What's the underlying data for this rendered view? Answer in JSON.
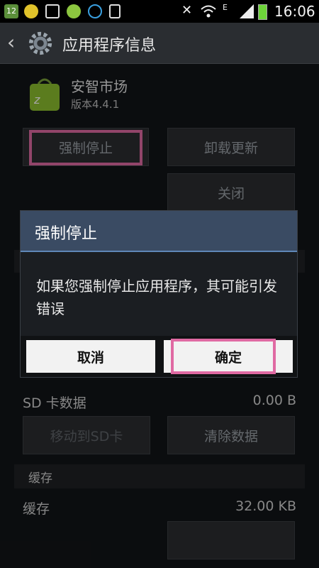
{
  "status_bar": {
    "time": "16:06",
    "left_icons": [
      "notification-12-icon",
      "game-icon",
      "image-icon",
      "plugin-icon",
      "p-app-icon",
      "phone-download-icon"
    ],
    "right_icons": [
      "mute-icon",
      "wifi-icon",
      "signal-e-icon",
      "signal-bars-icon",
      "battery-icon"
    ],
    "network_letter": "E",
    "badge_number": "12"
  },
  "header": {
    "title": "应用程序信息"
  },
  "app": {
    "name": "安智市场",
    "version": "版本4.4.1",
    "icon": "anzhi-bag-icon"
  },
  "buttons": {
    "force_stop": "强制停止",
    "uninstall_updates": "卸载更新",
    "disable": "关闭"
  },
  "storage": {
    "sd_label": "SD 卡数据",
    "sd_value": "0.00 B",
    "move_to_sd": "移动到SD卡",
    "clear_data": "清除数据"
  },
  "cache": {
    "section_title": "缓存",
    "label": "缓存",
    "value": "32.00 KB"
  },
  "dialog": {
    "title": "强制停止",
    "message": "如果您强制停止应用程序，其可能引发错误",
    "cancel": "取消",
    "confirm": "确定"
  },
  "colors": {
    "highlight": "#e06aa3",
    "dialog_title_bg": "#3a4b63",
    "dialog_accent": "#5f87b8",
    "battery": "#6ed43a"
  }
}
